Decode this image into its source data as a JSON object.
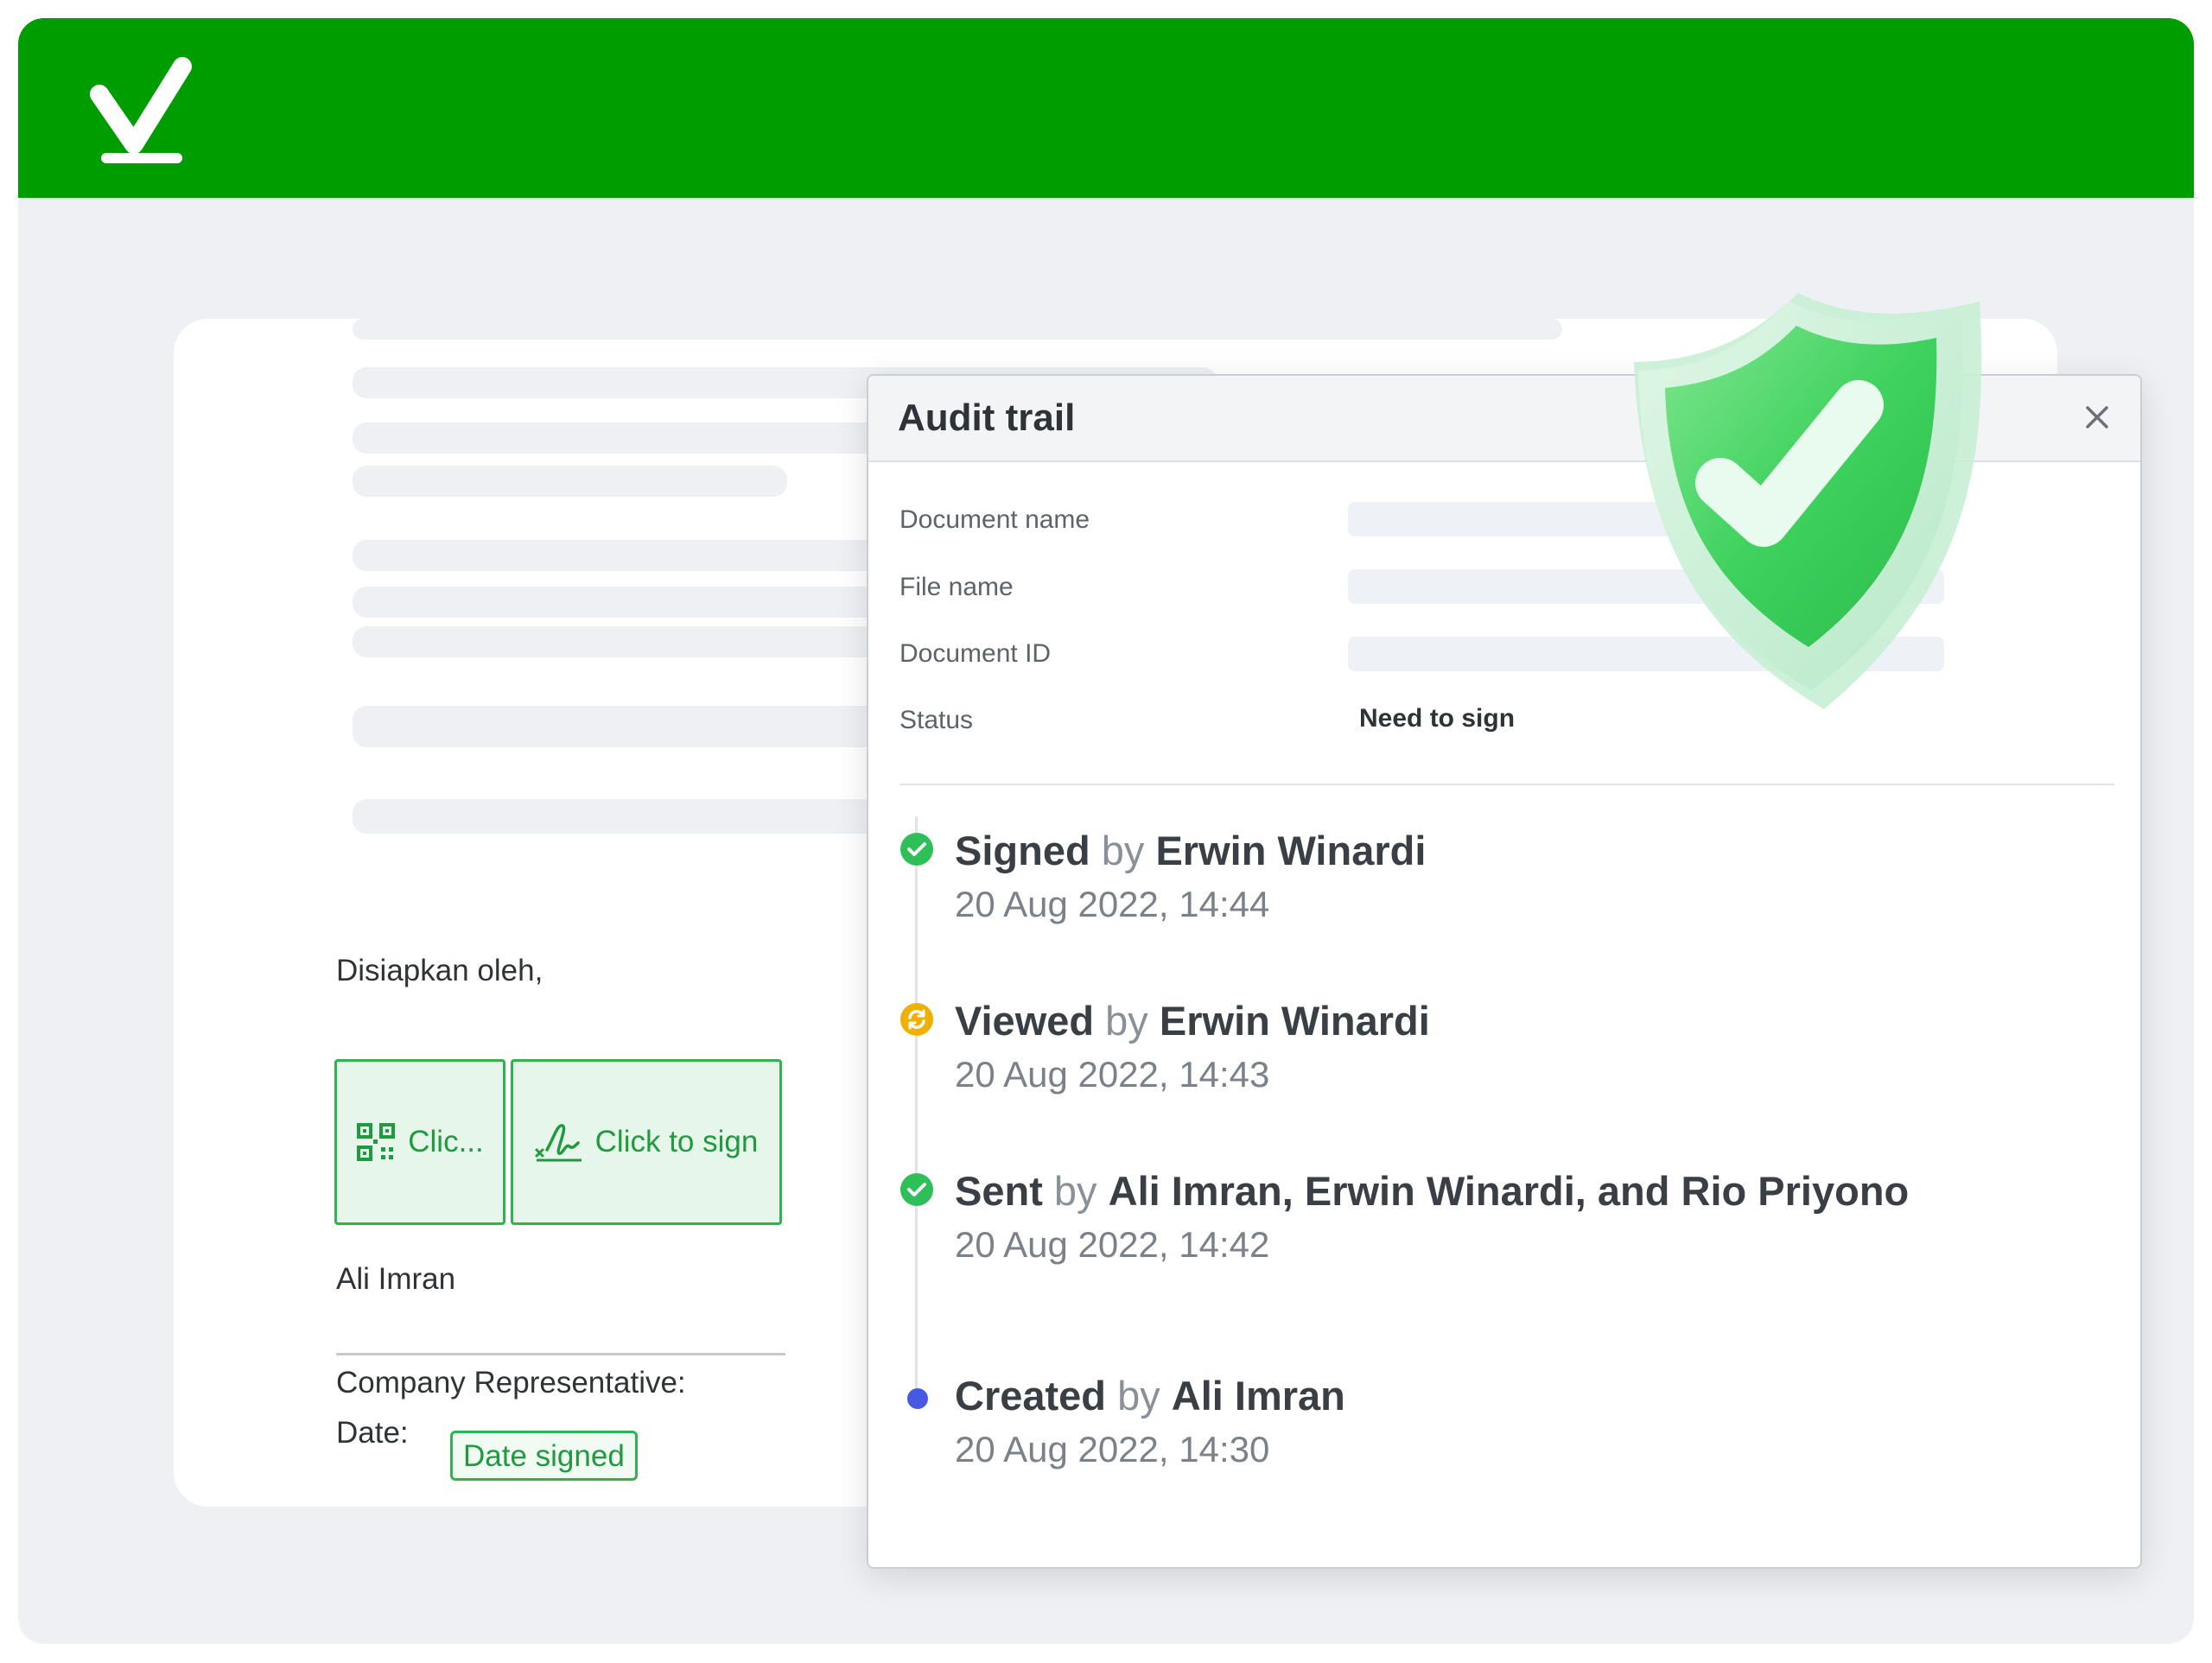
{
  "header": {
    "logo_icon": "checkmark-logo-icon",
    "brand_color": "#009d00"
  },
  "document": {
    "prepared_by_label": "Disiapkan oleh,",
    "qr_button_label": "Clic...",
    "qr_icon": "qr-code-icon",
    "sign_button_label": "Click to sign",
    "sign_icon": "signature-icon",
    "signer_name": "Ali Imran",
    "representative_label": "Company Representative:",
    "date_label": "Date:",
    "date_field_label": "Date signed"
  },
  "audit_trail": {
    "title": "Audit trail",
    "close_icon": "close-icon",
    "fields": [
      {
        "label": "Document name",
        "value": ""
      },
      {
        "label": "File name",
        "value": ""
      },
      {
        "label": "Document ID",
        "value": ""
      },
      {
        "label": "Status",
        "value": "Need to sign"
      }
    ],
    "events": [
      {
        "action": "Signed",
        "by_word": "by",
        "actor": "Erwin Winardi",
        "time": "20 Aug 2022, 14:44",
        "icon": "check-circle-icon",
        "color": "#2fbf58"
      },
      {
        "action": "Viewed",
        "by_word": "by",
        "actor": "Erwin Winardi",
        "time": "20 Aug 2022, 14:43",
        "icon": "refresh-circle-icon",
        "color": "#f0b000"
      },
      {
        "action": "Sent",
        "by_word": "by",
        "actor": "Ali Imran, Erwin Winardi, and Rio Priyono",
        "time": "20 Aug 2022, 14:42",
        "icon": "check-circle-icon",
        "color": "#2fbf58"
      },
      {
        "action": "Created",
        "by_word": "by",
        "actor": "Ali Imran",
        "time": "20 Aug 2022, 14:30",
        "icon": "dot-icon",
        "color": "#4759e0"
      }
    ]
  },
  "decoration": {
    "shield_icon": "shield-check-icon"
  }
}
